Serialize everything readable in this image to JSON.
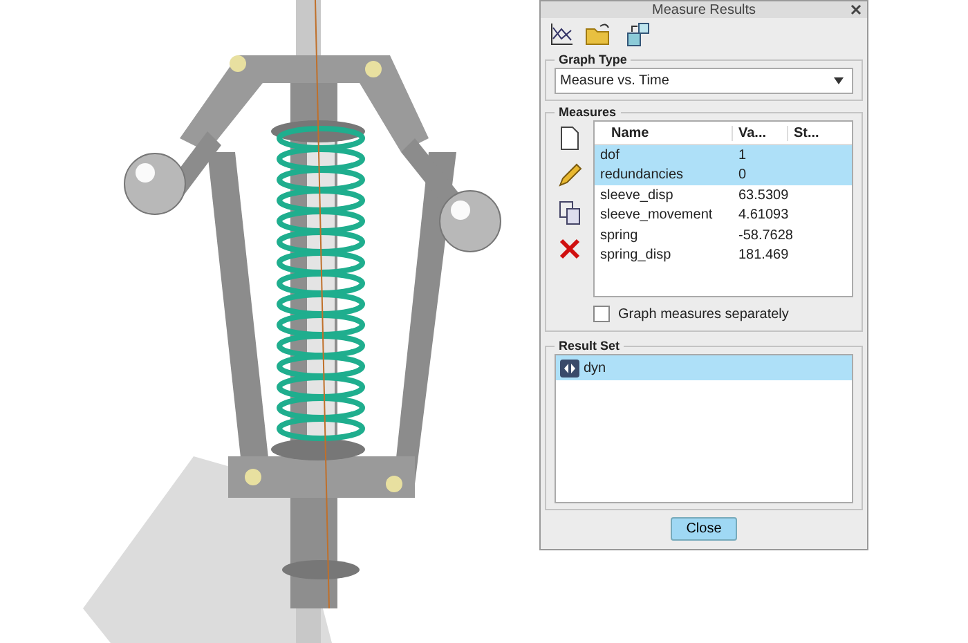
{
  "window": {
    "title": "Measure Results"
  },
  "graph_type": {
    "label": "Graph Type",
    "value": "Measure vs. Time"
  },
  "measures": {
    "label": "Measures",
    "columns": [
      "Name",
      "Va...",
      "St..."
    ],
    "rows": [
      {
        "name": "dof",
        "value": "1",
        "selected": true
      },
      {
        "name": "redundancies",
        "value": "0",
        "selected": true
      },
      {
        "name": "sleeve_disp",
        "value": "63.5309",
        "selected": false
      },
      {
        "name": "sleeve_movement",
        "value": "4.61093",
        "selected": false
      },
      {
        "name": "spring",
        "value": "-58.7628",
        "selected": false
      },
      {
        "name": "spring_disp",
        "value": "181.469",
        "selected": false
      }
    ],
    "checkbox": {
      "label": "Graph measures separately",
      "checked": false
    }
  },
  "result_set": {
    "label": "Result Set",
    "items": [
      {
        "name": "dyn",
        "selected": true
      }
    ]
  },
  "buttons": [
    "Close"
  ]
}
